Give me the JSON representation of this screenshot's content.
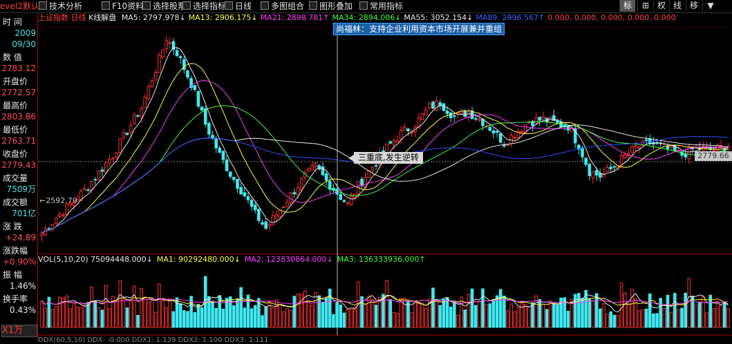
{
  "toolbar": {
    "left_label": "evel2默认",
    "items": [
      "技术分析",
      "F10资料",
      "选择股票",
      "选择指标",
      "日线",
      "多图组合",
      "图形叠加",
      "常用指标"
    ],
    "right_buttons": [
      "标",
      "⊞",
      "权",
      "线",
      "移",
      "▼"
    ]
  },
  "topbar": {
    "index_name": "上证指数",
    "period": "日线",
    "chart_kind": "K线解盘",
    "ma_items": [
      {
        "label": "MA5: 2797.978↓",
        "color": "#e8e8e8"
      },
      {
        "label": "MA13: 2906.175↓",
        "color": "#ffff40"
      },
      {
        "label": "MA21: 2898.781↑",
        "color": "#ff40ff"
      },
      {
        "label": "MA34: 2894.006↓",
        "color": "#40ff40"
      },
      {
        "label": "MA55: 3052.154↓",
        "color": "#e8e8e8"
      },
      {
        "label": "MA89: 2996.567↑",
        "color": "#4060ff"
      },
      {
        "label": "0.000, 0.000, 0.000, 0.000, 0.000",
        "color": "#ff4040"
      }
    ]
  },
  "news": {
    "text": "尚福林：支持企业利用资本市场开展兼并重组"
  },
  "callout": {
    "text": "三重底,发生逆转"
  },
  "price_tag": "2779.66",
  "low_label": "2592.79",
  "sidebar": {
    "fields": [
      {
        "label": "时  间",
        "value": "2009",
        "value2": "09/30",
        "color": "#4fe0e8"
      },
      {
        "label": "数  值",
        "value": "2783.12",
        "color": "#ff5050"
      },
      {
        "label": "开盘价",
        "value": "2772.57",
        "color": "#ff5050"
      },
      {
        "label": "最高价",
        "value": "2803.86",
        "color": "#ff5050"
      },
      {
        "label": "最低价",
        "value": "2763.71",
        "color": "#ff5050"
      },
      {
        "label": "收盘价",
        "value": "2779.43",
        "color": "#ff5050"
      },
      {
        "label": "成交量",
        "value": "7509万",
        "color": "#4fe0e8"
      },
      {
        "label": "成交额",
        "value": "701亿",
        "color": "#4fe0e8"
      },
      {
        "label": "涨  跌",
        "value": "+24.89",
        "color": "#ff5050"
      },
      {
        "label": "涨跌幅",
        "value": "+0.90%",
        "color": "#ff5050"
      },
      {
        "label": "振  幅",
        "value": "1.46%",
        "color": "#e8e8e8"
      },
      {
        "label": "换手率",
        "value": "0.43%",
        "color": "#e8e8e8"
      }
    ],
    "unit_label": "X1万"
  },
  "volbar": {
    "items": [
      {
        "label": "VOL(5,10,20) 75094448.000↓",
        "color": "#e8e8e8"
      },
      {
        "label": "MA1: 90292480.000↓",
        "color": "#ffff40"
      },
      {
        "label": "MA2: 123830864.000↓",
        "color": "#ff40ff"
      },
      {
        "label": "MA3: 136333936.000↑",
        "color": "#40ff40"
      }
    ]
  },
  "bottombar": {
    "text": "DDX(60,5,10) DDX: -0.000 DDX1: 1.139 DDX2: 1.100 DDX3: 1.111"
  },
  "colors": {
    "up": "#ff3030",
    "down": "#40e8f0",
    "ma5": "#e8e8e8",
    "ma13": "#ffff40",
    "ma21": "#ff40ff",
    "ma34": "#40ff40",
    "ma55": "#e8e8e8",
    "ma89": "#3050ff"
  },
  "chart_data": {
    "type": "candlestick",
    "title": "上证指数 日线",
    "ylim": [
      2540,
      3500
    ],
    "volume_max": 350000000,
    "waypoints": [
      [
        0,
        2620
      ],
      [
        5,
        2700
      ],
      [
        12,
        2800
      ],
      [
        20,
        2950
      ],
      [
        28,
        3150
      ],
      [
        33,
        3350
      ],
      [
        35,
        3440
      ],
      [
        38,
        3380
      ],
      [
        42,
        3250
      ],
      [
        46,
        3080
      ],
      [
        50,
        2950
      ],
      [
        53,
        2870
      ],
      [
        57,
        2780
      ],
      [
        60,
        2700
      ],
      [
        63,
        2640
      ],
      [
        66,
        2700
      ],
      [
        70,
        2780
      ],
      [
        74,
        2860
      ],
      [
        77,
        2900
      ],
      [
        80,
        2840
      ],
      [
        83,
        2790
      ],
      [
        86,
        2740
      ],
      [
        89,
        2820
      ],
      [
        93,
        2900
      ],
      [
        97,
        2980
      ],
      [
        101,
        3040
      ],
      [
        105,
        3080
      ],
      [
        109,
        3150
      ],
      [
        112,
        3170
      ],
      [
        116,
        3110
      ],
      [
        120,
        3130
      ],
      [
        124,
        3090
      ],
      [
        127,
        3050
      ],
      [
        130,
        3000
      ],
      [
        133,
        3040
      ],
      [
        137,
        3090
      ],
      [
        141,
        3100
      ],
      [
        145,
        3080
      ],
      [
        148,
        3070
      ],
      [
        151,
        2990
      ],
      [
        154,
        2880
      ],
      [
        157,
        2860
      ],
      [
        160,
        2890
      ],
      [
        163,
        2930
      ],
      [
        167,
        2980
      ],
      [
        171,
        3000
      ],
      [
        175,
        2980
      ],
      [
        180,
        2950
      ],
      [
        184,
        2980
      ],
      [
        189,
        2970
      ],
      [
        193,
        2990
      ]
    ]
  }
}
